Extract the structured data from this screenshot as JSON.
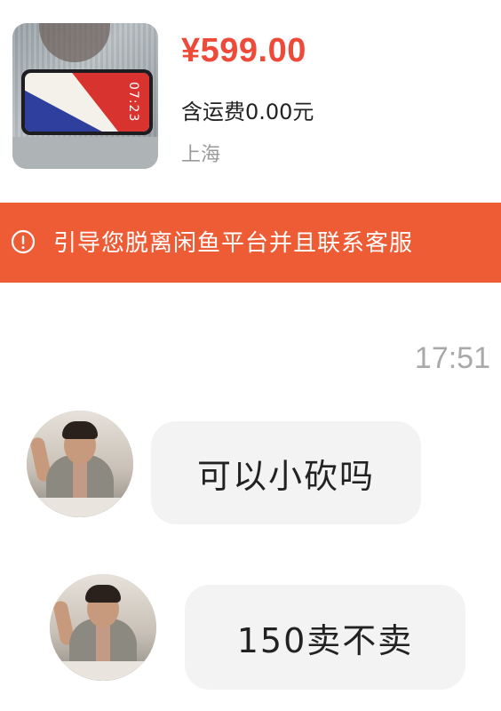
{
  "product": {
    "price": "¥599.00",
    "shipping": "含运费0.00元",
    "location": "上海",
    "thumbnail": {
      "clock_text": "07:23"
    }
  },
  "warning_banner": {
    "icon": "alert-circle-icon",
    "text": "引导您脱离闲鱼平台并且联系客服",
    "background_color": "#ee5c35"
  },
  "chat": {
    "timestamp": "17:51",
    "messages": [
      {
        "text": "可以小砍吗"
      },
      {
        "text": "150卖不卖"
      }
    ]
  },
  "colors": {
    "price": "#ee4a3a",
    "bubble": "#f3f3f3",
    "timestamp": "#a9a9a9"
  }
}
